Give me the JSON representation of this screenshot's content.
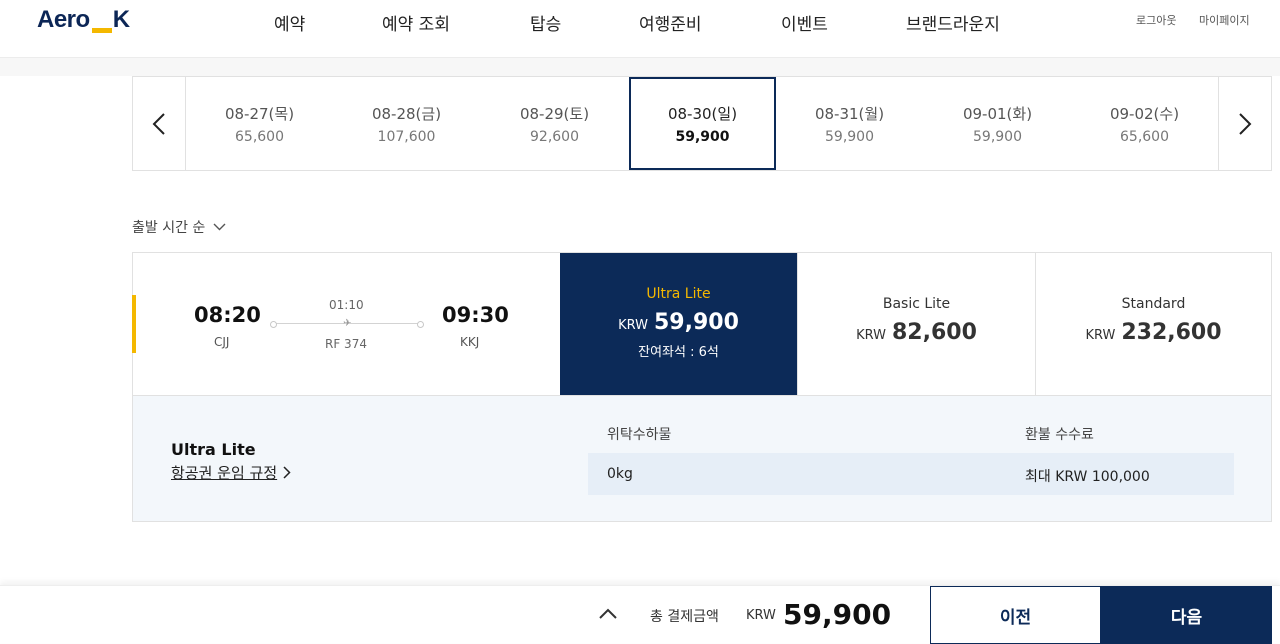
{
  "header": {
    "logo_left": "Aero",
    "logo_right": "K",
    "nav": [
      "예약",
      "예약 조회",
      "탑승",
      "여행준비",
      "이벤트",
      "브랜드라운지"
    ],
    "login": "로그아웃",
    "mypage": "마이페이지"
  },
  "dates": [
    {
      "date": "08-27(목)",
      "price": "65,600"
    },
    {
      "date": "08-28(금)",
      "price": "107,600"
    },
    {
      "date": "08-29(토)",
      "price": "92,600"
    },
    {
      "date": "08-30(일)",
      "price": "59,900"
    },
    {
      "date": "08-31(월)",
      "price": "59,900"
    },
    {
      "date": "09-01(화)",
      "price": "59,900"
    },
    {
      "date": "09-02(수)",
      "price": "65,600"
    }
  ],
  "sort_label": "출발 시간 순",
  "flight": {
    "dep_time": "08:20",
    "dep_airport": "CJJ",
    "duration": "01:10",
    "flight_no": "RF 374",
    "arr_time": "09:30",
    "arr_airport": "KKJ"
  },
  "fares": {
    "ultra": {
      "name": "Ultra Lite",
      "currency": "KRW",
      "price": "59,900",
      "seats": "잔여좌석 : 6석"
    },
    "basic": {
      "name": "Basic Lite",
      "currency": "KRW",
      "price": "82,600"
    },
    "standard": {
      "name": "Standard",
      "currency": "KRW",
      "price": "232,600"
    }
  },
  "detail": {
    "fare_name": "Ultra Lite",
    "rule_link": "항공권 운임 규정",
    "baggage_header": "위탁수하물",
    "baggage_value": "0kg",
    "refund_header": "환불 수수료",
    "refund_value": "최대 KRW 100,000"
  },
  "bottom": {
    "total_label": "총 결제금액",
    "currency": "KRW",
    "total": "59,900",
    "prev": "이전",
    "next": "다음"
  },
  "colors": {
    "navy": "#0c2a58",
    "accent": "#f4b800"
  }
}
